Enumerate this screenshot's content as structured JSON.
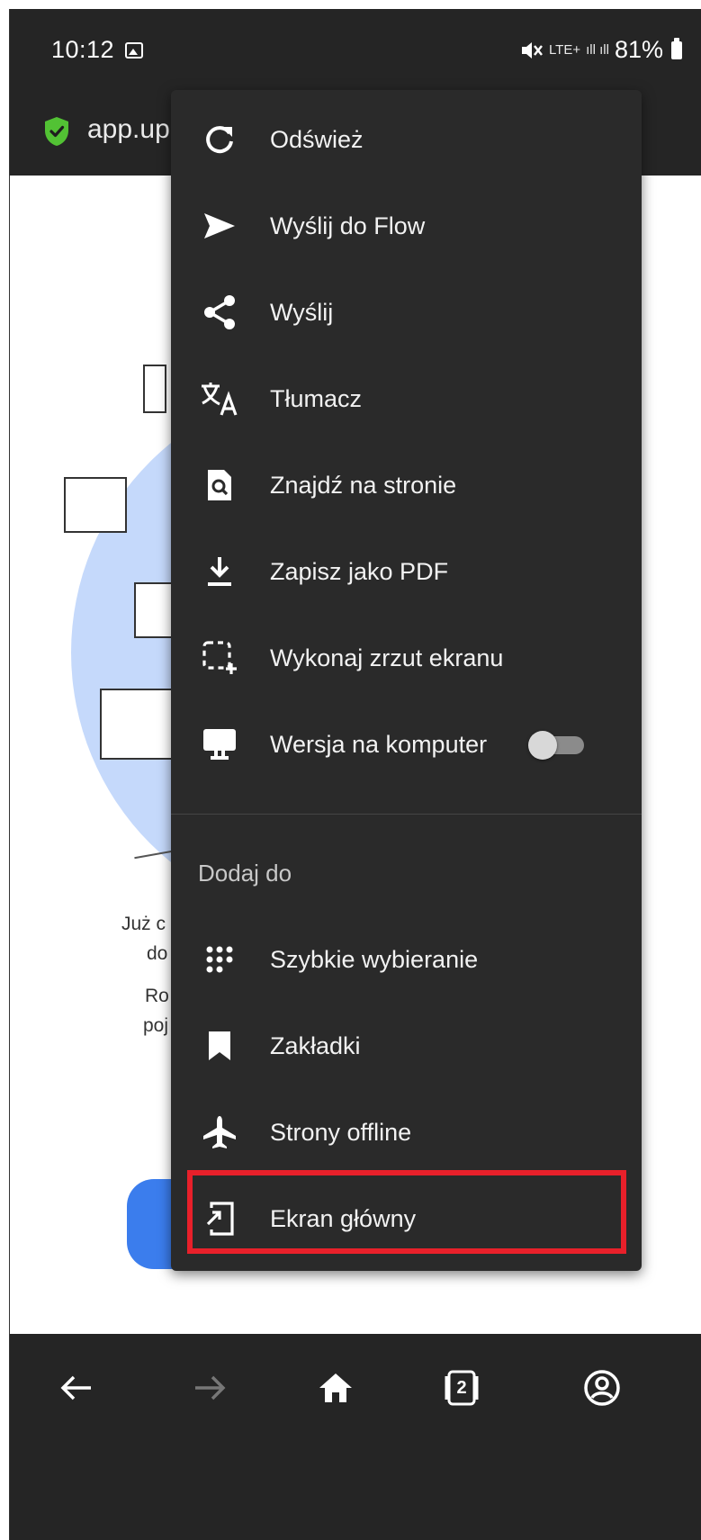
{
  "status_bar": {
    "time": "10:12",
    "network_small": "LTE+",
    "signal": "ıll ıll",
    "battery": "81%"
  },
  "address_bar": {
    "url": "app.up"
  },
  "page": {
    "text_line1": "Już c",
    "text_line2": "do",
    "text_line3": "Ro",
    "text_line4": "poj"
  },
  "menu": {
    "items": [
      {
        "label": "Odśwież",
        "icon": "refresh-icon"
      },
      {
        "label": "Wyślij do Flow",
        "icon": "send-icon"
      },
      {
        "label": "Wyślij",
        "icon": "share-icon"
      },
      {
        "label": "Tłumacz",
        "icon": "translate-icon"
      },
      {
        "label": "Znajdź na stronie",
        "icon": "find-in-page-icon"
      },
      {
        "label": "Zapisz jako PDF",
        "icon": "download-icon"
      },
      {
        "label": "Wykonaj zrzut ekranu",
        "icon": "screenshot-icon"
      },
      {
        "label": "Wersja na komputer",
        "icon": "desktop-icon",
        "toggle": false
      }
    ],
    "section_title": "Dodaj do",
    "add_items": [
      {
        "label": "Szybkie wybieranie",
        "icon": "speed-dial-icon"
      },
      {
        "label": "Zakładki",
        "icon": "bookmark-icon"
      },
      {
        "label": "Strony offline",
        "icon": "airplane-icon"
      },
      {
        "label": "Ekran główny",
        "icon": "add-to-home-icon"
      }
    ],
    "highlighted_item": "Ekran główny",
    "highlight_color": "#e8202a"
  },
  "bottom_nav": {
    "tabs_count": "2"
  }
}
